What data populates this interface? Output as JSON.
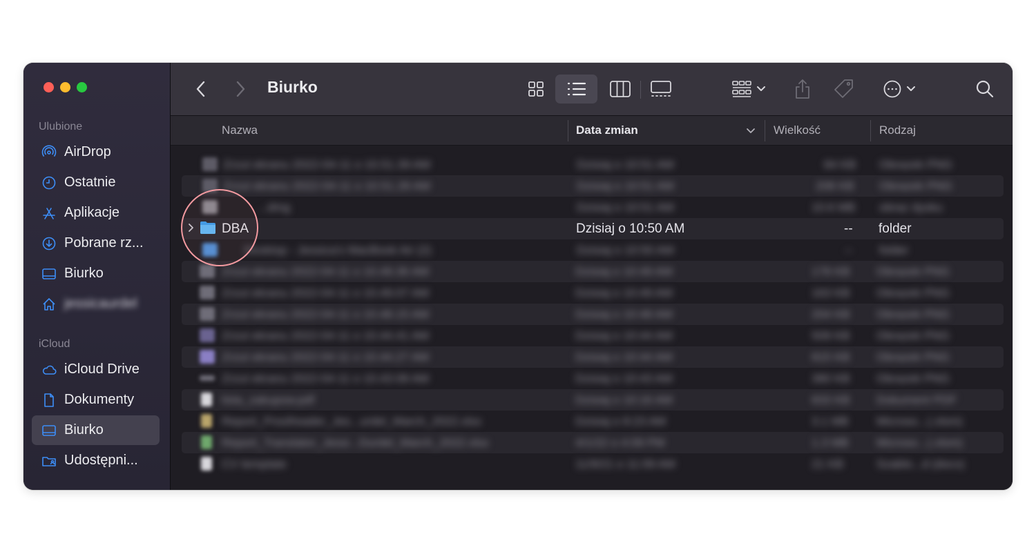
{
  "window": {
    "title": "Biurko",
    "traffic_lights": {
      "close": "#fe5f57",
      "minimize": "#febc2e",
      "maximize": "#28c840"
    }
  },
  "sidebar": {
    "sections": [
      {
        "label": "Ulubione",
        "items": [
          {
            "label": "AirDrop",
            "icon": "airdrop-icon"
          },
          {
            "label": "Ostatnie",
            "icon": "clock-icon"
          },
          {
            "label": "Aplikacje",
            "icon": "applications-icon"
          },
          {
            "label": "Pobrane rz...",
            "icon": "download-icon"
          },
          {
            "label": "Biurko",
            "icon": "desktop-icon"
          },
          {
            "label": "jessicaurdel",
            "icon": "home-icon"
          }
        ]
      },
      {
        "label": "iCloud",
        "items": [
          {
            "label": "iCloud Drive",
            "icon": "cloud-icon"
          },
          {
            "label": "Dokumenty",
            "icon": "document-icon"
          },
          {
            "label": "Biurko",
            "icon": "desktop-icon",
            "selected": true
          },
          {
            "label": "Udostępni...",
            "icon": "shared-folder-icon"
          }
        ]
      }
    ]
  },
  "toolbar": {
    "view_modes": [
      "icon-view-icon",
      "list-view-icon",
      "column-view-icon",
      "gallery-view-icon"
    ],
    "selected_view": "list-view-icon"
  },
  "columns": {
    "name": "Nazwa",
    "date": "Data zmian",
    "size": "Wielkość",
    "kind": "Rodzaj"
  },
  "files": [
    {
      "name": "Zrzut ekranu 2022-04-11 o 10.51.39 AM",
      "date": "Dzisiaj o 10:51 AM",
      "size": "84 KB",
      "kind": "Obrazek PNG",
      "blurred": true
    },
    {
      "name": "Zrzut ekranu 2022-04-11 o 10.51.28 AM",
      "date": "Dzisiaj o 10:51 AM",
      "size": "208 KB",
      "kind": "Obrazek PNG",
      "blurred": true
    },
    {
      "name": "...dmg",
      "date": "Dzisiaj o 10:51 AM",
      "size": "10.6 MB",
      "kind": "obraz dysku",
      "blurred": true
    },
    {
      "name": "DBA",
      "date": "Dzisiaj o 10:50 AM",
      "size": "--",
      "kind": "folder",
      "blurred": false
    },
    {
      "name": "Desktop - Jessica's MacBook Air (2)",
      "date": "Dzisiaj o 10:50 AM",
      "size": "--",
      "kind": "folder",
      "blurred": true
    },
    {
      "name": "Zrzut ekranu 2022-04-11 o 10.49.36 AM",
      "date": "Dzisiaj o 10:49 AM",
      "size": "178 KB",
      "kind": "Obrazek PNG",
      "blurred": true
    },
    {
      "name": "Zrzut ekranu 2022-04-11 o 10.49.07 AM",
      "date": "Dzisiaj o 10:49 AM",
      "size": "163 KB",
      "kind": "Obrazek PNG",
      "blurred": true
    },
    {
      "name": "Zrzut ekranu 2022-04-11 o 10.48.15 AM",
      "date": "Dzisiaj o 10:48 AM",
      "size": "204 KB",
      "kind": "Obrazek PNG",
      "blurred": true
    },
    {
      "name": "Zrzut ekranu 2022-04-11 o 10.44.41 AM",
      "date": "Dzisiaj o 10:44 AM",
      "size": "509 KB",
      "kind": "Obrazek PNG",
      "blurred": true
    },
    {
      "name": "Zrzut ekranu 2022-04-11 o 10.44.27 AM",
      "date": "Dzisiaj o 10:44 AM",
      "size": "815 KB",
      "kind": "Obrazek PNG",
      "blurred": true
    },
    {
      "name": "Zrzut ekranu 2022-04-11 o 10.43.08 AM",
      "date": "Dzisiaj o 10:43 AM",
      "size": "380 KB",
      "kind": "Obrazek PNG",
      "blurred": true
    },
    {
      "name": "lista_zakupow.pdf",
      "date": "Dzisiaj o 10:16 AM",
      "size": "833 KB",
      "kind": "Dokument PDF",
      "blurred": true
    },
    {
      "name": "Report_Proofreader_Jes...urdel_March_2022.xlsx",
      "date": "Dzisiaj o 8:23 AM",
      "size": "3.1 MB",
      "kind": "Microso...(.xlsm)",
      "blurred": true
    },
    {
      "name": "Report_Translator_Jessi...Durdel_March_2022.xlsx",
      "date": "4/1/22 o 4:09 PM",
      "size": "1.3 MB",
      "kind": "Microso...(.xlsm)",
      "blurred": true
    },
    {
      "name": "CV template",
      "date": "11/9/21 o 11:09 AM",
      "size": "21 KB",
      "kind": "Szablo...d (docx)",
      "blurred": true
    }
  ],
  "highlight": {
    "target": "DBA"
  }
}
